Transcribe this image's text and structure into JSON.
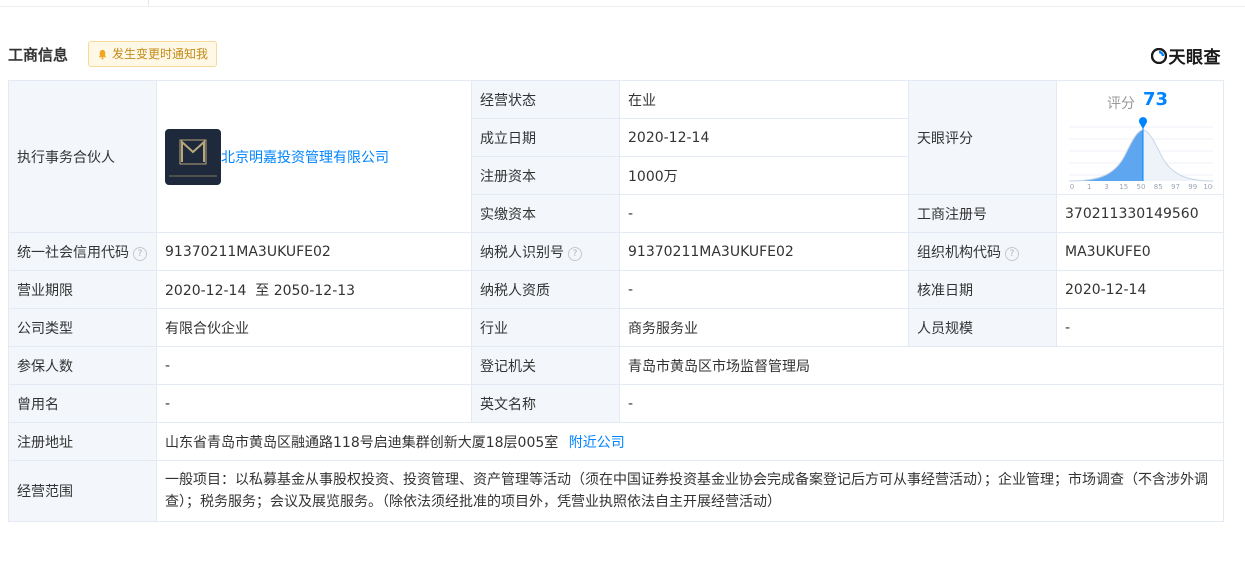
{
  "header": {
    "title": "工商信息",
    "notify_label": "发生变更时通知我",
    "brand": "天眼查"
  },
  "rows": {
    "partner_label": "执行事务合伙人",
    "partner_name": "北京明嘉投资管理有限公司",
    "status_label": "经营状态",
    "status_value": "在业",
    "founded_label": "成立日期",
    "founded_value": "2020-12-14",
    "capital_label": "注册资本",
    "capital_value": "1000万",
    "paid_label": "实缴资本",
    "paid_value": "-",
    "score_label": "天眼评分",
    "score_title": "评分",
    "score_value": "73",
    "score_ticks": [
      "0",
      "1",
      "3",
      "15",
      "50",
      "85",
      "97",
      "99",
      "100"
    ],
    "regno_label": "工商注册号",
    "regno_value": "370211330149560",
    "credit_label": "统一社会信用代码",
    "credit_value": "91370211MA3UKUFE02",
    "taxid_label": "纳税人识别号",
    "taxid_value": "91370211MA3UKUFE02",
    "org_label": "组织机构代码",
    "org_value": "MA3UKUFE0",
    "term_label": "营业期限",
    "term_value": "2020-12-14  至 2050-12-13",
    "taxq_label": "纳税人资质",
    "taxq_value": "-",
    "approve_label": "核准日期",
    "approve_value": "2020-12-14",
    "type_label": "公司类型",
    "type_value": "有限合伙企业",
    "industry_label": "行业",
    "industry_value": "商务服务业",
    "staff_label": "人员规模",
    "staff_value": "-",
    "insured_label": "参保人数",
    "insured_value": "-",
    "authority_label": "登记机关",
    "authority_value": "青岛市黄岛区市场监督管理局",
    "former_label": "曾用名",
    "former_value": "-",
    "english_label": "英文名称",
    "english_value": "-",
    "address_label": "注册地址",
    "address_value": "山东省青岛市黄岛区融通路118号启迪集群创新大厦18层005室",
    "nearby_label": "附近公司",
    "scope_label": "经营范围",
    "scope_value": "一般项目：以私募基金从事股权投资、投资管理、资产管理等活动（须在中国证券投资基金业协会完成备案登记后方可从事经营活动）；企业管理；市场调查（不含涉外调查）；税务服务；会议及展览服务。（除依法须经批准的项目外，凭营业执照依法自主开展经营活动）"
  },
  "colors": {
    "accent": "#0084ff",
    "label_bg": "#f3f7fc",
    "border": "#e4eaf3",
    "notify_bg": "#fff8e6",
    "notify_text": "#c28b19"
  }
}
